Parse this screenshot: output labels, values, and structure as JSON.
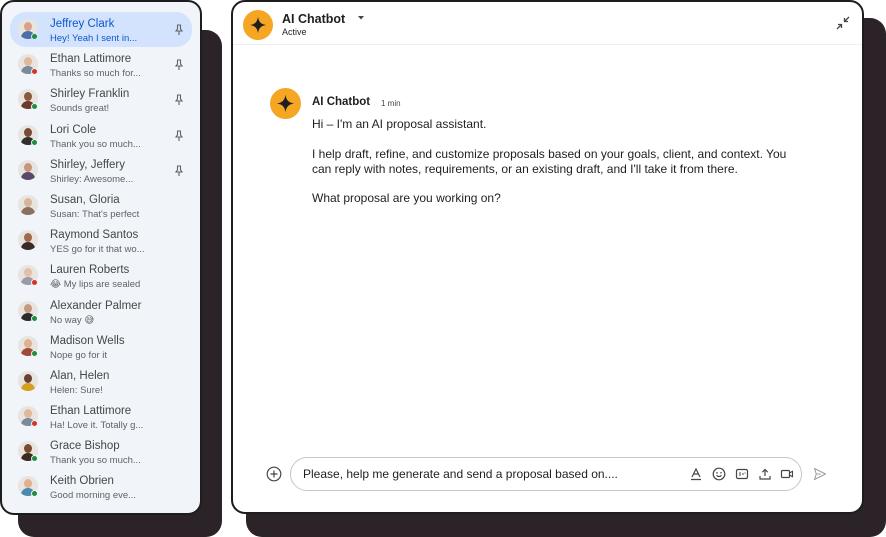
{
  "sidebar": {
    "conversations": [
      {
        "name": "Jeffrey Clark",
        "preview": "Hey! Yeah I sent in...",
        "status": "online",
        "pinned": true,
        "active": true,
        "shirt": "#4a6fa5",
        "skin": "#d9a38a"
      },
      {
        "name": "Ethan Lattimore",
        "preview": "Thanks so much for...",
        "status": "busy",
        "pinned": true,
        "active": false,
        "shirt": "#7a8a9a",
        "skin": "#e0b89a"
      },
      {
        "name": "Shirley Franklin",
        "preview": "Sounds great!",
        "status": "online",
        "pinned": true,
        "active": false,
        "shirt": "#6b3a2a",
        "skin": "#8a5a40"
      },
      {
        "name": "Lori Cole",
        "preview": "Thank you so much...",
        "status": "online",
        "pinned": true,
        "active": false,
        "shirt": "#2f2f2f",
        "skin": "#7a4a35"
      },
      {
        "name": "Shirley, Jeffery",
        "preview": "Shirley: Awesome...",
        "status": "none",
        "pinned": true,
        "active": false,
        "shirt": "#5a4a6a",
        "skin": "#c9957a"
      },
      {
        "name": "Susan, Gloria",
        "preview": "Susan: That's perfect",
        "status": "none",
        "pinned": false,
        "active": false,
        "shirt": "#8a7060",
        "skin": "#d8b49a"
      },
      {
        "name": "Raymond Santos",
        "preview": "YES go for it that wo...",
        "status": "none",
        "pinned": false,
        "active": false,
        "shirt": "#3a2a2a",
        "skin": "#a06a4a"
      },
      {
        "name": "Lauren Roberts",
        "preview": "😂 My lips are sealed",
        "status": "busy",
        "pinned": false,
        "active": false,
        "shirt": "#9a9aa8",
        "skin": "#e2c0a8"
      },
      {
        "name": "Alexander Palmer",
        "preview": "No way 😅",
        "status": "online",
        "pinned": false,
        "active": false,
        "shirt": "#2a2a2a",
        "skin": "#c49a80"
      },
      {
        "name": "Madison Wells",
        "preview": "Nope go for it",
        "status": "online",
        "pinned": false,
        "active": false,
        "shirt": "#a04a3a",
        "skin": "#e0b090"
      },
      {
        "name": "Alan, Helen",
        "preview": "Helen: Sure!",
        "status": "none",
        "pinned": false,
        "active": false,
        "shirt": "#d4a020",
        "skin": "#6a4030"
      },
      {
        "name": "Ethan Lattimore",
        "preview": "Ha! Love it. Totally g...",
        "status": "busy",
        "pinned": false,
        "active": false,
        "shirt": "#7a8a9a",
        "skin": "#e0b89a"
      },
      {
        "name": "Grace Bishop",
        "preview": "Thank you so much...",
        "status": "online",
        "pinned": false,
        "active": false,
        "shirt": "#3a2a20",
        "skin": "#7a4a30"
      },
      {
        "name": "Keith Obrien",
        "preview": "Good morning eve...",
        "status": "online",
        "pinned": false,
        "active": false,
        "shirt": "#4a8ab0",
        "skin": "#e0b090"
      }
    ]
  },
  "chat": {
    "title": "AI Chatbot",
    "status": "Active",
    "message": {
      "sender": "AI Chatbot",
      "time": "1 min",
      "line1": "Hi – I'm an AI proposal assistant.",
      "line2": "I help draft, refine, and customize proposals based on your goals, client, and context. You",
      "line3": "can reply with notes, requirements, or an existing draft, and I'll take it from there.",
      "line4": "What proposal are you working on?"
    },
    "composer": {
      "value": "Please, help me generate and send a proposal based on....",
      "placeholder": ""
    }
  },
  "colors": {
    "accent": "#0b57d0",
    "active_bg": "#d3e3fd",
    "bot": "#f5a623",
    "online": "#1e8e3e",
    "busy": "#d93025"
  }
}
